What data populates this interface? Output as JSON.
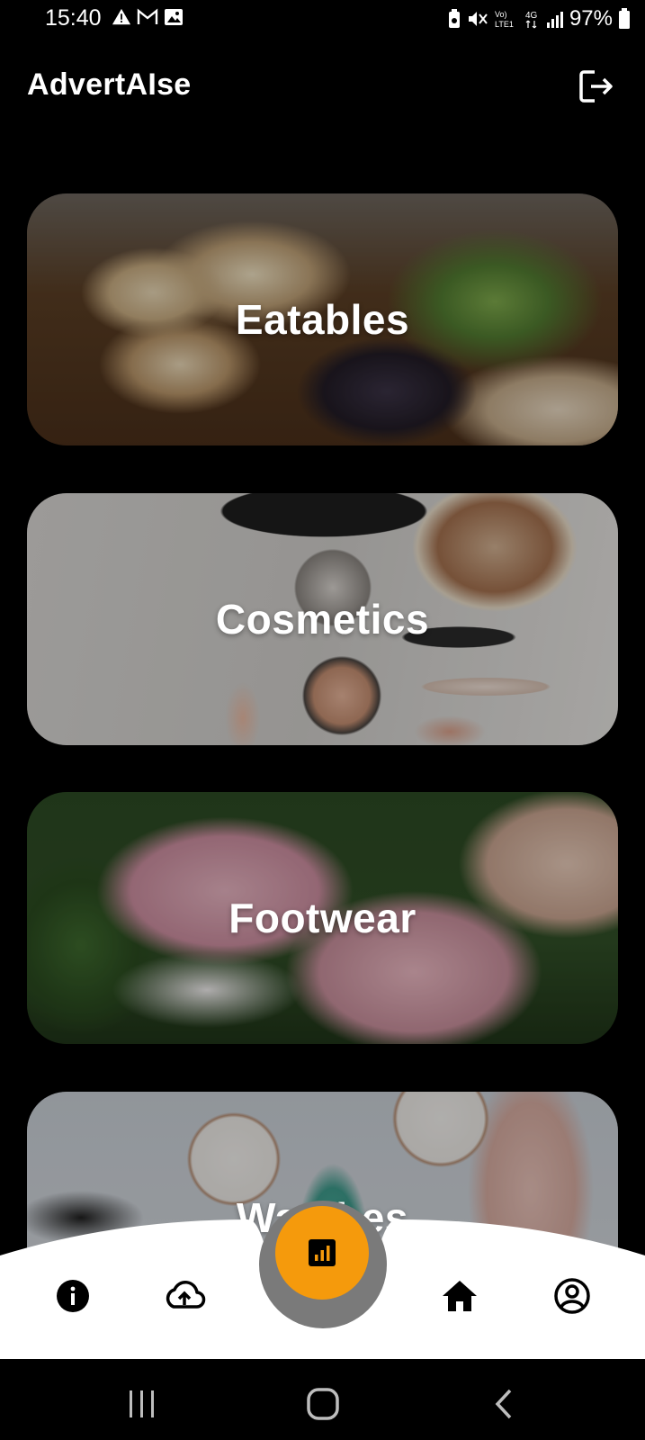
{
  "status_bar": {
    "time": "15:40",
    "battery": "97%"
  },
  "app": {
    "title": "AdvertAIse"
  },
  "categories": [
    {
      "label": "Eatables"
    },
    {
      "label": "Cosmetics"
    },
    {
      "label": "Footwear"
    },
    {
      "label": "Watches"
    }
  ],
  "bottom_nav": {
    "items": [
      {
        "icon": "info-icon"
      },
      {
        "icon": "cloud-upload-icon"
      },
      {
        "icon": "bar-chart-icon"
      },
      {
        "icon": "home-icon"
      },
      {
        "icon": "account-circle-icon"
      }
    ],
    "accent_color": "#f59a0c"
  }
}
